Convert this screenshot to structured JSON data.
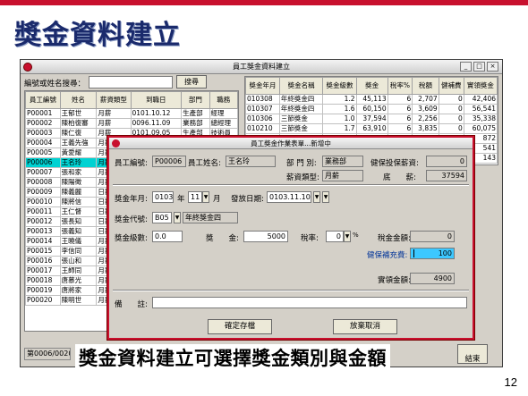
{
  "slide": {
    "title": "獎金資料建立",
    "caption": "獎金資料建立可選擇獎金類別與金額",
    "page_number": "12"
  },
  "main_window": {
    "title": "員工獎金資料建立",
    "search_label": "編號或姓名搜尋：",
    "search_value": "",
    "search_button": "搜尋",
    "status_text": "第0006/0020",
    "end_button": "結束",
    "left_columns": [
      "員工編號",
      "姓名",
      "薪資類型",
      "到職日",
      "部門",
      "職務"
    ],
    "left_rows": [
      [
        "P00001",
        "王郁世",
        "月薪",
        "0101.10.12",
        "生產部",
        "經理"
      ],
      [
        "P00002",
        "陳柏復審",
        "月薪",
        "0096.11.09",
        "業務部",
        "總經理"
      ],
      [
        "P00003",
        "陳仁復",
        "月薪",
        "0101.09.05",
        "生產部",
        "技術員"
      ],
      [
        "P00004",
        "王義先強",
        "月薪",
        "",
        "",
        ""
      ],
      [
        "P00005",
        "黃愛耀",
        "月薪",
        "",
        "",
        ""
      ],
      [
        "P00006",
        "王名玲",
        "月薪",
        "",
        "",
        ""
      ],
      [
        "P00007",
        "張和家",
        "月薪",
        "",
        "",
        ""
      ],
      [
        "P00008",
        "陳陽徵",
        "月薪",
        "",
        "",
        ""
      ],
      [
        "P00009",
        "陳義麗",
        "日薪",
        "",
        "",
        ""
      ],
      [
        "P00010",
        "陳將信",
        "日薪",
        "",
        "",
        ""
      ],
      [
        "P00011",
        "王仁督",
        "日薪",
        "",
        "",
        ""
      ],
      [
        "P00012",
        "張長知",
        "日薪",
        "",
        "",
        ""
      ],
      [
        "P00013",
        "張義知",
        "日薪",
        "",
        "",
        ""
      ],
      [
        "P00014",
        "王曉儀",
        "月薪",
        "",
        "",
        ""
      ],
      [
        "P00015",
        "李信同",
        "月薪",
        "",
        "",
        ""
      ],
      [
        "P00016",
        "張山和",
        "月薪",
        "",
        "",
        ""
      ],
      [
        "P00017",
        "王師同",
        "月薪",
        "",
        "",
        ""
      ],
      [
        "P00018",
        "唐慕光",
        "月薪",
        "",
        "",
        ""
      ],
      [
        "P00019",
        "唐將家",
        "月薪",
        "",
        "",
        ""
      ],
      [
        "P00020",
        "陳明世",
        "月薪",
        "",
        "",
        ""
      ]
    ],
    "selected_row_index": 5,
    "right_columns": [
      "獎金年月",
      "獎金名稱",
      "獎金級數",
      "獎金",
      "稅率%",
      "稅額",
      "健補費",
      "實領獎金"
    ],
    "right_rows": [
      [
        "010308",
        "年終獎金四",
        "1.2",
        "45,113",
        "6",
        "2,707",
        "0",
        "42,406"
      ],
      [
        "010307",
        "年終獎金四",
        "1.6",
        "60,150",
        "6",
        "3,609",
        "0",
        "56,541"
      ],
      [
        "010306",
        "三節獎金",
        "1.0",
        "37,594",
        "6",
        "2,256",
        "0",
        "35,338"
      ],
      [
        "010210",
        "三節獎金",
        "1.7",
        "63,910",
        "6",
        "3,835",
        "0",
        "60,075"
      ],
      [
        "",
        "",
        "",
        "",
        "",
        "",
        "",
        "872"
      ],
      [
        "",
        "",
        "",
        "",
        "",
        "",
        "",
        "541"
      ],
      [
        "",
        "",
        "",
        "",
        "",
        "",
        "",
        "143"
      ]
    ]
  },
  "dialog": {
    "title": "員工獎金作業表單...新增中",
    "emp_id_label": "員工編號:",
    "emp_id": "P00006",
    "emp_name_label": "員工姓名:",
    "emp_name": "王名玲",
    "dept_label": "部 門 別:",
    "dept": "業務部",
    "insurance_label": "健保投保薪資:",
    "insurance": "0",
    "salary_type_label": "薪資類型:",
    "salary_type": "月薪",
    "base_label": "底　　薪:",
    "base": "37594",
    "ym_label": "獎金年月:",
    "year": "0103",
    "year_unit": "年",
    "month": "11",
    "month_unit": "月",
    "pay_date_label": "發放日期:",
    "pay_date": "0103.11.10",
    "code_label": "獎金代號:",
    "code": "B05",
    "code_name": "年終獎金四",
    "level_label": "獎金級數:",
    "level": "0.0",
    "amount_label": "獎　　金:",
    "amount": "5000",
    "rate_label": "稅率:",
    "rate": "0",
    "rate_unit": "%",
    "tax_label": "稅金金額:",
    "tax": "0",
    "health_label": "健保補充費:",
    "health": "100",
    "net_label": "實領金額:",
    "net": "4900",
    "remark_label": "備　　註:",
    "remark": "",
    "save_button": "確定存檔",
    "cancel_button": "放棄取消"
  }
}
